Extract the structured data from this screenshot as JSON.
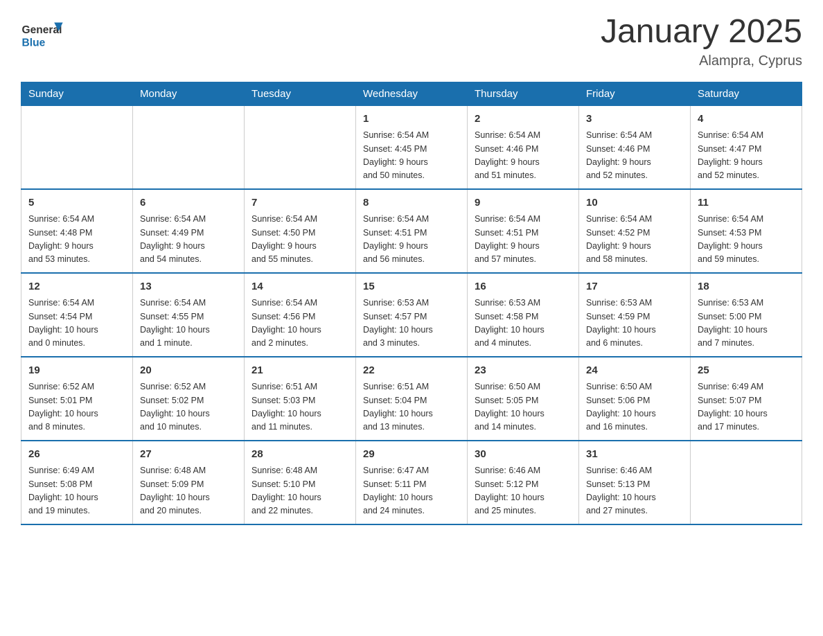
{
  "header": {
    "logo_general": "General",
    "logo_blue": "Blue",
    "main_title": "January 2025",
    "subtitle": "Alampra, Cyprus"
  },
  "days_of_week": [
    "Sunday",
    "Monday",
    "Tuesday",
    "Wednesday",
    "Thursday",
    "Friday",
    "Saturday"
  ],
  "weeks": [
    [
      {
        "day": "",
        "info": ""
      },
      {
        "day": "",
        "info": ""
      },
      {
        "day": "",
        "info": ""
      },
      {
        "day": "1",
        "info": "Sunrise: 6:54 AM\nSunset: 4:45 PM\nDaylight: 9 hours\nand 50 minutes."
      },
      {
        "day": "2",
        "info": "Sunrise: 6:54 AM\nSunset: 4:46 PM\nDaylight: 9 hours\nand 51 minutes."
      },
      {
        "day": "3",
        "info": "Sunrise: 6:54 AM\nSunset: 4:46 PM\nDaylight: 9 hours\nand 52 minutes."
      },
      {
        "day": "4",
        "info": "Sunrise: 6:54 AM\nSunset: 4:47 PM\nDaylight: 9 hours\nand 52 minutes."
      }
    ],
    [
      {
        "day": "5",
        "info": "Sunrise: 6:54 AM\nSunset: 4:48 PM\nDaylight: 9 hours\nand 53 minutes."
      },
      {
        "day": "6",
        "info": "Sunrise: 6:54 AM\nSunset: 4:49 PM\nDaylight: 9 hours\nand 54 minutes."
      },
      {
        "day": "7",
        "info": "Sunrise: 6:54 AM\nSunset: 4:50 PM\nDaylight: 9 hours\nand 55 minutes."
      },
      {
        "day": "8",
        "info": "Sunrise: 6:54 AM\nSunset: 4:51 PM\nDaylight: 9 hours\nand 56 minutes."
      },
      {
        "day": "9",
        "info": "Sunrise: 6:54 AM\nSunset: 4:51 PM\nDaylight: 9 hours\nand 57 minutes."
      },
      {
        "day": "10",
        "info": "Sunrise: 6:54 AM\nSunset: 4:52 PM\nDaylight: 9 hours\nand 58 minutes."
      },
      {
        "day": "11",
        "info": "Sunrise: 6:54 AM\nSunset: 4:53 PM\nDaylight: 9 hours\nand 59 minutes."
      }
    ],
    [
      {
        "day": "12",
        "info": "Sunrise: 6:54 AM\nSunset: 4:54 PM\nDaylight: 10 hours\nand 0 minutes."
      },
      {
        "day": "13",
        "info": "Sunrise: 6:54 AM\nSunset: 4:55 PM\nDaylight: 10 hours\nand 1 minute."
      },
      {
        "day": "14",
        "info": "Sunrise: 6:54 AM\nSunset: 4:56 PM\nDaylight: 10 hours\nand 2 minutes."
      },
      {
        "day": "15",
        "info": "Sunrise: 6:53 AM\nSunset: 4:57 PM\nDaylight: 10 hours\nand 3 minutes."
      },
      {
        "day": "16",
        "info": "Sunrise: 6:53 AM\nSunset: 4:58 PM\nDaylight: 10 hours\nand 4 minutes."
      },
      {
        "day": "17",
        "info": "Sunrise: 6:53 AM\nSunset: 4:59 PM\nDaylight: 10 hours\nand 6 minutes."
      },
      {
        "day": "18",
        "info": "Sunrise: 6:53 AM\nSunset: 5:00 PM\nDaylight: 10 hours\nand 7 minutes."
      }
    ],
    [
      {
        "day": "19",
        "info": "Sunrise: 6:52 AM\nSunset: 5:01 PM\nDaylight: 10 hours\nand 8 minutes."
      },
      {
        "day": "20",
        "info": "Sunrise: 6:52 AM\nSunset: 5:02 PM\nDaylight: 10 hours\nand 10 minutes."
      },
      {
        "day": "21",
        "info": "Sunrise: 6:51 AM\nSunset: 5:03 PM\nDaylight: 10 hours\nand 11 minutes."
      },
      {
        "day": "22",
        "info": "Sunrise: 6:51 AM\nSunset: 5:04 PM\nDaylight: 10 hours\nand 13 minutes."
      },
      {
        "day": "23",
        "info": "Sunrise: 6:50 AM\nSunset: 5:05 PM\nDaylight: 10 hours\nand 14 minutes."
      },
      {
        "day": "24",
        "info": "Sunrise: 6:50 AM\nSunset: 5:06 PM\nDaylight: 10 hours\nand 16 minutes."
      },
      {
        "day": "25",
        "info": "Sunrise: 6:49 AM\nSunset: 5:07 PM\nDaylight: 10 hours\nand 17 minutes."
      }
    ],
    [
      {
        "day": "26",
        "info": "Sunrise: 6:49 AM\nSunset: 5:08 PM\nDaylight: 10 hours\nand 19 minutes."
      },
      {
        "day": "27",
        "info": "Sunrise: 6:48 AM\nSunset: 5:09 PM\nDaylight: 10 hours\nand 20 minutes."
      },
      {
        "day": "28",
        "info": "Sunrise: 6:48 AM\nSunset: 5:10 PM\nDaylight: 10 hours\nand 22 minutes."
      },
      {
        "day": "29",
        "info": "Sunrise: 6:47 AM\nSunset: 5:11 PM\nDaylight: 10 hours\nand 24 minutes."
      },
      {
        "day": "30",
        "info": "Sunrise: 6:46 AM\nSunset: 5:12 PM\nDaylight: 10 hours\nand 25 minutes."
      },
      {
        "day": "31",
        "info": "Sunrise: 6:46 AM\nSunset: 5:13 PM\nDaylight: 10 hours\nand 27 minutes."
      },
      {
        "day": "",
        "info": ""
      }
    ]
  ]
}
